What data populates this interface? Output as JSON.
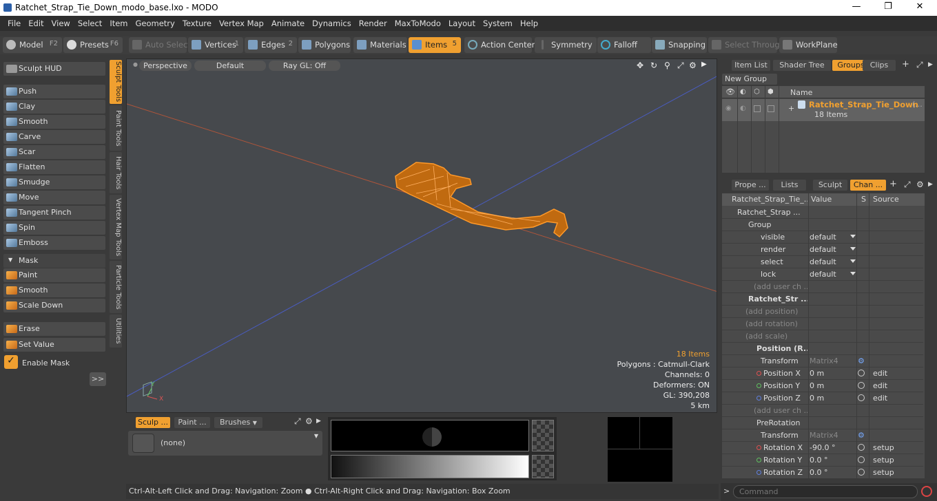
{
  "window": {
    "title": "Ratchet_Strap_Tie_Down_modo_base.lxo - MODO",
    "minimize": "—",
    "maximize": "❐",
    "close": "✕"
  },
  "menu": [
    "File",
    "Edit",
    "View",
    "Select",
    "Item",
    "Geometry",
    "Texture",
    "Vertex Map",
    "Animate",
    "Dynamics",
    "Render",
    "MaxToModo",
    "Layout",
    "System",
    "Help"
  ],
  "toolbar": {
    "model": "Model",
    "model_key": "F2",
    "presets": "Presets",
    "presets_key": "F6",
    "auto_select": "Auto Select",
    "vertices": "Vertices",
    "vertices_key": "1",
    "edges": "Edges",
    "edges_key": "2",
    "polygons": "Polygons",
    "materials": "Materials",
    "items": "Items",
    "items_key": "5",
    "action_center": "Action Center",
    "symmetry": "Symmetry",
    "falloff": "Falloff",
    "snapping": "Snapping",
    "select_through": "Select Through",
    "workplane": "WorkPlane"
  },
  "sculpt": {
    "hud": "Sculpt HUD",
    "tools": [
      "Push",
      "Clay",
      "Smooth",
      "Carve",
      "Scar",
      "Flatten",
      "Smudge",
      "Move",
      "Tangent Pinch",
      "Spin",
      "Emboss"
    ],
    "mask_header": "Mask",
    "mask_tools": [
      "Paint",
      "Smooth",
      "Scale Down"
    ],
    "erase": "Erase",
    "set_value": "Set Value",
    "enable_mask": "Enable Mask",
    "more": ">>"
  },
  "vtabs": [
    "Sculpt Tools",
    "Paint Tools",
    "Hair Tools",
    "Vertex Map Tools",
    "Particle Tools",
    "Utilities"
  ],
  "viewport": {
    "view": "Perspective",
    "shading": "Default",
    "raygl": "Ray GL: Off",
    "stats": {
      "items": "18 Items",
      "polygons": "Polygons : Catmull-Clark",
      "channels": "Channels: 0",
      "deformers": "Deformers: ON",
      "gl": "GL: 390,208",
      "scale": "5 km"
    },
    "axis_y": "Y",
    "axis_x": "X"
  },
  "brush": {
    "tabs": [
      "Sculp ...",
      "Paint ...",
      "Brushes"
    ],
    "preset": "(none)"
  },
  "status": "Ctrl-Alt-Left Click and Drag: Navigation: Zoom ● Ctrl-Alt-Right Click and Drag: Navigation: Box Zoom",
  "groups_panel": {
    "tabs": [
      "Item List",
      "Shader Tree",
      "Groups",
      "Clips"
    ],
    "new_group": "New Group",
    "name_col": "Name",
    "group_name": "Ratchet_Strap_Tie_Down",
    "group_suffix": "(...",
    "group_count": "18 Items"
  },
  "channels_panel": {
    "tabs": [
      "Prope ...",
      "Lists",
      "Sculpt",
      "Chan ..."
    ],
    "cols": {
      "name": "Ratchet_Strap_Tie_...",
      "value": "Value",
      "s": "S",
      "source": "Source"
    },
    "rows": [
      {
        "n": "Ratchet_Strap ...",
        "v": "",
        "src": "",
        "ind": 22,
        "bold": false
      },
      {
        "n": "Group",
        "v": "",
        "src": "",
        "ind": 38
      },
      {
        "n": "visible",
        "v": "default",
        "src": "",
        "ind": 56,
        "dd": true
      },
      {
        "n": "render",
        "v": "default",
        "src": "",
        "ind": 56,
        "dd": true
      },
      {
        "n": "select",
        "v": "default",
        "src": "",
        "ind": 56,
        "dd": true
      },
      {
        "n": "lock",
        "v": "default",
        "src": "",
        "ind": 56,
        "dd": true
      },
      {
        "n": "(add user ch ...",
        "v": "",
        "src": "",
        "ind": 46,
        "dim": true
      },
      {
        "n": "Ratchet_Str ...",
        "v": "",
        "src": "",
        "ind": 38,
        "bold": true
      },
      {
        "n": "(add position)",
        "v": "",
        "src": "",
        "ind": 34,
        "dim": true
      },
      {
        "n": "(add rotation)",
        "v": "",
        "src": "",
        "ind": 34,
        "dim": true
      },
      {
        "n": "(add scale)",
        "v": "",
        "src": "",
        "ind": 34,
        "dim": true
      },
      {
        "n": "Position (R...",
        "v": "",
        "src": "",
        "ind": 50,
        "bold": true
      },
      {
        "n": "Transform",
        "v": "Matrix4",
        "src": "",
        "ind": 56,
        "vdim": true,
        "gear": true
      },
      {
        "n": "Position X",
        "v": "0 m",
        "src": "edit",
        "ind": 50,
        "dot": "#e05050",
        "s": true
      },
      {
        "n": "Position Y",
        "v": "0 m",
        "src": "edit",
        "ind": 50,
        "dot": "#60c060",
        "s": true
      },
      {
        "n": "Position Z",
        "v": "0 m",
        "src": "edit",
        "ind": 50,
        "dot": "#6080e0",
        "s": true
      },
      {
        "n": "(add user ch ...",
        "v": "",
        "src": "",
        "ind": 46,
        "dim": true
      },
      {
        "n": "PreRotation",
        "v": "",
        "src": "",
        "ind": 50
      },
      {
        "n": "Transform",
        "v": "Matrix4",
        "src": "",
        "ind": 56,
        "vdim": true,
        "gear": true
      },
      {
        "n": "Rotation X",
        "v": "-90.0 °",
        "src": "setup",
        "ind": 50,
        "dot": "#e05050",
        "s": true
      },
      {
        "n": "Rotation Y",
        "v": "0.0 °",
        "src": "setup",
        "ind": 50,
        "dot": "#60c060",
        "s": true
      },
      {
        "n": "Rotation Z",
        "v": "0.0 °",
        "src": "setup",
        "ind": 50,
        "dot": "#6080e0",
        "s": true
      }
    ]
  },
  "command": {
    "placeholder": "Command",
    "prompt": ">"
  }
}
